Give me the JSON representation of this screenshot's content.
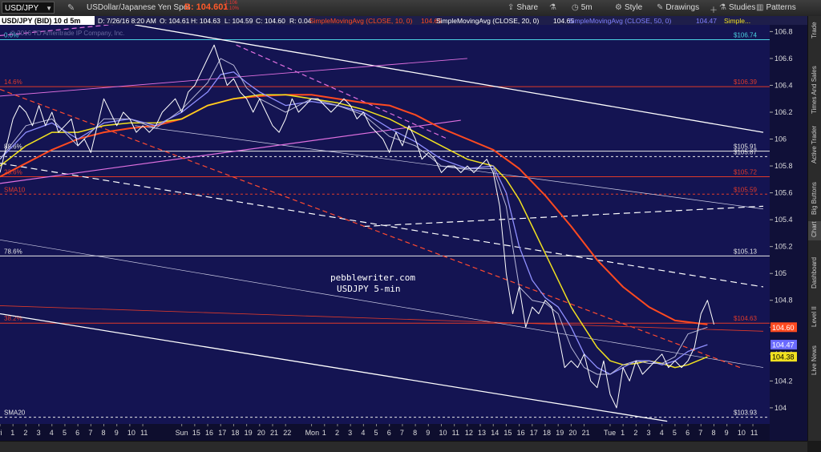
{
  "toolbar": {
    "symbol": "USD/JPY",
    "description": "USDollar/Japanese Yen Spot",
    "bid_label": "B: 104.601",
    "change_top": "-1.106",
    "change_bottom": "-1.10%",
    "tools": [
      {
        "name": "share",
        "label": "Share",
        "icon": "share-icon"
      },
      {
        "name": "studies-flask",
        "label": "",
        "icon": "flask-icon"
      },
      {
        "name": "timeframe",
        "label": "5m",
        "icon": "clock-icon"
      },
      {
        "name": "style",
        "label": "Style",
        "icon": "gear-icon"
      },
      {
        "name": "drawings",
        "label": "Drawings",
        "icon": "pencil-icon"
      },
      {
        "name": "add",
        "label": "",
        "icon": "plus-icon"
      },
      {
        "name": "studies",
        "label": "Studies",
        "icon": "flask-icon"
      },
      {
        "name": "patterns",
        "label": "Patterns",
        "icon": "bars-icon"
      }
    ]
  },
  "sidebar_tabs": [
    "Trade",
    "Times And Sales",
    "Active Trader",
    "Big Buttons",
    "Chart",
    "Dashboard",
    "Level II",
    "Live News"
  ],
  "sidebar_active": "Chart",
  "chart_data": {
    "type": "line",
    "header": {
      "title": "USD/JPY (BID) 10 d 5m",
      "date": "D: 7/26/16 8:20 AM",
      "open": "O: 104.61",
      "high": "H: 104.63",
      "low": "L: 104.59",
      "close": "C: 104.60",
      "range": "R: 0.04",
      "sma10_label": "SimpleMovingAvg (CLOSE, 10, 0)",
      "sma10_value": "104.65",
      "sma20_label": "SimpleMovingAvg (CLOSE, 20, 0)",
      "sma20_value": "104.65",
      "sma50_label": "SimpleMovingAvg (CLOSE, 50, 0)",
      "sma50_value": "104.47",
      "simple_label": "Simple...",
      "copyright": "© 2016 TD Ameritrade IP Company, Inc."
    },
    "annotation": [
      "pebblewriter.com",
      "USDJPY 5-min"
    ],
    "ylim": [
      103.88,
      106.85
    ],
    "y_ticks": [
      104,
      104.2,
      104.4,
      104.6,
      104.8,
      105,
      105.2,
      105.4,
      105.6,
      105.8,
      106,
      106.2,
      106.4,
      106.6,
      106.8
    ],
    "y_tick_labels": [
      "104",
      "104.2",
      "104.4",
      "104.6",
      "104.8",
      "105",
      "105.2",
      "105.4",
      "105.6",
      "105.8",
      "106",
      "106.2",
      "106.4",
      "106.6",
      "106.8"
    ],
    "x_ticks": [
      {
        "label": "Fri",
        "x": 0
      },
      {
        "label": "1",
        "x": 1
      },
      {
        "label": "2",
        "x": 2
      },
      {
        "label": "3",
        "x": 3
      },
      {
        "label": "4",
        "x": 4
      },
      {
        "label": "5",
        "x": 5
      },
      {
        "label": "6",
        "x": 6
      },
      {
        "label": "7",
        "x": 7
      },
      {
        "label": "8",
        "x": 8
      },
      {
        "label": "9",
        "x": 9
      },
      {
        "label": "10",
        "x": 10
      },
      {
        "label": "11",
        "x": 11
      },
      {
        "label": "Sun",
        "x": 14
      },
      {
        "label": "15",
        "x": 15
      },
      {
        "label": "16",
        "x": 16
      },
      {
        "label": "17",
        "x": 17
      },
      {
        "label": "18",
        "x": 18
      },
      {
        "label": "19",
        "x": 19
      },
      {
        "label": "20",
        "x": 20
      },
      {
        "label": "21",
        "x": 21
      },
      {
        "label": "22",
        "x": 22
      },
      {
        "label": "Mon",
        "x": 24
      },
      {
        "label": "1",
        "x": 25
      },
      {
        "label": "2",
        "x": 26
      },
      {
        "label": "3",
        "x": 27
      },
      {
        "label": "4",
        "x": 28
      },
      {
        "label": "5",
        "x": 29
      },
      {
        "label": "6",
        "x": 30
      },
      {
        "label": "7",
        "x": 31
      },
      {
        "label": "8",
        "x": 32
      },
      {
        "label": "9",
        "x": 33
      },
      {
        "label": "10",
        "x": 34
      },
      {
        "label": "11",
        "x": 35
      },
      {
        "label": "12",
        "x": 36
      },
      {
        "label": "13",
        "x": 37
      },
      {
        "label": "14",
        "x": 38
      },
      {
        "label": "15",
        "x": 39
      },
      {
        "label": "16",
        "x": 40
      },
      {
        "label": "17",
        "x": 41
      },
      {
        "label": "18",
        "x": 42
      },
      {
        "label": "19",
        "x": 43
      },
      {
        "label": "20",
        "x": 44
      },
      {
        "label": "21",
        "x": 45
      },
      {
        "label": "Tue",
        "x": 47
      },
      {
        "label": "1",
        "x": 48
      },
      {
        "label": "2",
        "x": 49
      },
      {
        "label": "3",
        "x": 50
      },
      {
        "label": "4",
        "x": 51
      },
      {
        "label": "5",
        "x": 52
      },
      {
        "label": "6",
        "x": 53
      },
      {
        "label": "7",
        "x": 54
      },
      {
        "label": "8",
        "x": 55
      },
      {
        "label": "9",
        "x": 56
      },
      {
        "label": "10",
        "x": 57
      },
      {
        "label": "11",
        "x": 58
      }
    ],
    "xlim": [
      0,
      58.8
    ],
    "levels": [
      {
        "name": "top-pct",
        "label": "100.0%",
        "value": 106.86,
        "right_label": "106.86",
        "color": "#dcdcdc",
        "dash": ""
      },
      {
        "name": "level-0",
        "label": "0.0%",
        "value": 106.74,
        "right_label": "$106.74",
        "color": "#4ad0e0",
        "dash": ""
      },
      {
        "name": "level-14",
        "label": "14.6%",
        "value": 106.39,
        "right_label": "$106.39",
        "color": "#e03a2a",
        "dash": ""
      },
      {
        "name": "level-88",
        "label": "88.6%",
        "value": 105.91,
        "right_label": "$105.91",
        "color": "#e8e8e8",
        "dash": ""
      },
      {
        "name": "level-sub",
        "label": "",
        "value": 105.87,
        "right_label": "$105.87",
        "color": "#e8e8e8",
        "dash": "3,3"
      },
      {
        "name": "level-23",
        "label": "23.6%",
        "value": 105.72,
        "right_label": "$105.72",
        "color": "#e03a2a",
        "dash": ""
      },
      {
        "name": "level-sma10",
        "label": "SMA10",
        "value": 105.59,
        "right_label": "$105.59",
        "color": "#e03a2a",
        "dash": "3,3"
      },
      {
        "name": "level-78",
        "label": "78.6%",
        "value": 105.13,
        "right_label": "$105.13",
        "color": "#e8e8e8",
        "dash": ""
      },
      {
        "name": "level-38",
        "label": "38.2%",
        "value": 104.63,
        "right_label": "$104.63",
        "color": "#e03a2a",
        "dash": ""
      },
      {
        "name": "level-sma20",
        "label": "SMA20",
        "value": 103.93,
        "right_label": "$103.93",
        "color": "#e8e8e8",
        "dash": "3,3"
      }
    ],
    "trendlines": [
      {
        "name": "white-channel-top",
        "points": [
          [
            10.4,
            106.85
          ],
          [
            58.8,
            106.05
          ]
        ],
        "color": "#ffffff",
        "width": 1.3,
        "dash": ""
      },
      {
        "name": "white-channel-bottom",
        "points": [
          [
            0,
            104.7
          ],
          [
            51.4,
            103.9
          ]
        ],
        "color": "#ffffff",
        "width": 1.3,
        "dash": ""
      },
      {
        "name": "white-thin-1",
        "points": [
          [
            0,
            105.25
          ],
          [
            58.8,
            104.3
          ]
        ],
        "color": "#cfcfe8",
        "width": 0.7,
        "dash": ""
      },
      {
        "name": "white-thin-2",
        "points": [
          [
            10.4,
            106.1
          ],
          [
            58.8,
            105.48
          ]
        ],
        "color": "#cfcfe8",
        "width": 0.7,
        "dash": ""
      },
      {
        "name": "white-dash-rising",
        "points": [
          [
            28,
            105.35
          ],
          [
            58.8,
            105.5
          ]
        ],
        "color": "#ffffff",
        "width": 1.2,
        "dash": "8,5"
      },
      {
        "name": "white-dash-falling",
        "points": [
          [
            0,
            105.82
          ],
          [
            58.8,
            104.9
          ]
        ],
        "color": "#ffffff",
        "width": 1.2,
        "dash": "8,5"
      },
      {
        "name": "magenta-upper",
        "points": [
          [
            0,
            106.32
          ],
          [
            36,
            106.6
          ]
        ],
        "color": "#e070e0",
        "width": 0.9,
        "dash": ""
      },
      {
        "name": "magenta-lower",
        "points": [
          [
            0,
            105.67
          ],
          [
            35.5,
            106.14
          ]
        ],
        "color": "#e070e0",
        "width": 1.2,
        "dash": ""
      },
      {
        "name": "magenta-dash-top",
        "points": [
          [
            0,
            106.77
          ],
          [
            10.5,
            106.87
          ]
        ],
        "color": "#e070e0",
        "width": 1.2,
        "dash": "6,4"
      },
      {
        "name": "magenta-dash-desc",
        "points": [
          [
            18.2,
            106.7
          ],
          [
            34.5,
            106.0
          ]
        ],
        "color": "#e070e0",
        "width": 1.2,
        "dash": "6,4"
      },
      {
        "name": "red-dash-desc",
        "points": [
          [
            0,
            106.37
          ],
          [
            57,
            104.3
          ]
        ],
        "color": "#ff4a30",
        "width": 1.2,
        "dash": "6,4"
      },
      {
        "name": "red-thin-long",
        "points": [
          [
            0,
            104.76
          ],
          [
            58.8,
            104.57
          ]
        ],
        "color": "#e03a2a",
        "width": 0.8,
        "dash": ""
      }
    ],
    "series": [
      {
        "key": "price",
        "color": "#ffffff",
        "width": 1,
        "x": [
          0,
          0.5,
          1,
          1.5,
          2,
          2.5,
          3,
          3.5,
          4,
          4.5,
          5,
          5.5,
          6,
          6.5,
          7,
          7.5,
          8,
          8.5,
          9,
          9.5,
          10,
          10.5,
          11,
          11.5,
          12,
          12.5,
          13,
          13.5,
          14,
          14.5,
          15,
          15.5,
          16,
          16.5,
          17,
          17.5,
          18,
          18.5,
          19,
          19.5,
          20,
          20.5,
          21,
          21.5,
          22,
          22.5,
          23,
          23.5,
          24,
          24.5,
          25,
          25.5,
          26,
          26.5,
          27,
          27.5,
          28,
          28.5,
          29,
          29.5,
          30,
          30.5,
          31,
          31.5,
          32,
          32.5,
          33,
          33.5,
          34,
          34.5,
          35,
          35.5,
          36,
          36.5,
          37,
          37.5,
          38,
          38.5,
          39,
          39.5,
          40,
          40.5,
          41,
          41.5,
          42,
          42.5,
          43,
          43.5,
          44,
          44.5,
          45,
          45.5,
          46,
          46.5,
          47,
          47.5,
          48,
          48.5,
          49,
          49.5,
          50,
          50.5,
          51,
          51.5,
          52,
          52.5,
          53,
          53.5,
          54,
          54.5,
          55
        ],
        "values": [
          105.75,
          105.95,
          106.15,
          106.25,
          106.2,
          106.1,
          106.25,
          106.1,
          106.2,
          106.05,
          106.1,
          106.15,
          105.95,
          106.0,
          105.9,
          106.1,
          106.3,
          106.2,
          106.1,
          106.2,
          106.15,
          106.05,
          106.1,
          106.05,
          106.1,
          106.2,
          106.25,
          106.3,
          106.2,
          106.35,
          106.4,
          106.5,
          106.6,
          106.7,
          106.55,
          106.4,
          106.45,
          106.35,
          106.3,
          106.2,
          106.3,
          106.2,
          106.1,
          106.05,
          106.15,
          106.3,
          106.2,
          106.25,
          106.3,
          106.3,
          106.25,
          106.2,
          106.25,
          106.3,
          106.25,
          106.15,
          106.2,
          106.1,
          106.05,
          106.0,
          105.9,
          106.05,
          105.95,
          106.1,
          106.0,
          105.85,
          105.9,
          105.85,
          105.75,
          105.8,
          105.8,
          105.75,
          105.8,
          105.75,
          105.8,
          105.85,
          105.75,
          105.5,
          105.0,
          104.7,
          104.9,
          104.6,
          104.75,
          104.7,
          104.8,
          104.75,
          104.55,
          104.3,
          104.35,
          104.3,
          104.4,
          104.2,
          104.15,
          104.35,
          104.1,
          104.0,
          104.3,
          104.2,
          104.35,
          104.25,
          104.3,
          104.35,
          104.4,
          104.3,
          104.35,
          104.3,
          104.35,
          104.45,
          104.7,
          104.8,
          104.62
        ]
      },
      {
        "key": "sma-red",
        "color": "#ff4a20",
        "width": 2,
        "x": [
          0,
          2,
          4,
          6,
          8,
          10,
          12,
          14,
          16,
          18,
          20,
          22,
          24,
          26,
          28,
          30,
          32,
          34,
          36,
          38,
          40,
          42,
          44,
          46,
          48,
          50,
          52,
          54.5
        ],
        "values": [
          105.72,
          105.82,
          105.92,
          106.0,
          106.05,
          106.08,
          106.1,
          106.15,
          106.25,
          106.3,
          106.32,
          106.33,
          106.33,
          106.3,
          106.27,
          106.25,
          106.18,
          106.08,
          106.0,
          105.92,
          105.78,
          105.58,
          105.35,
          105.1,
          104.9,
          104.75,
          104.65,
          104.62
        ]
      },
      {
        "key": "sma-yellow",
        "color": "#f0e020",
        "width": 1.5,
        "x": [
          0,
          2,
          4,
          6,
          8,
          10,
          12,
          14,
          16,
          18,
          20,
          22,
          24,
          26,
          28,
          30,
          32,
          34,
          36,
          38,
          39,
          40,
          41,
          42,
          43,
          44,
          45,
          46,
          47,
          48,
          49,
          50,
          51,
          52,
          53,
          54.5
        ],
        "values": [
          105.8,
          105.95,
          106.05,
          106.05,
          106.1,
          106.12,
          106.12,
          106.15,
          106.25,
          106.3,
          106.33,
          106.33,
          106.3,
          106.27,
          106.22,
          106.15,
          106.05,
          105.95,
          105.85,
          105.8,
          105.7,
          105.55,
          105.35,
          105.15,
          104.95,
          104.75,
          104.6,
          104.45,
          104.35,
          104.32,
          104.33,
          104.35,
          104.33,
          104.3,
          104.32,
          104.38
        ]
      },
      {
        "key": "sma-blue",
        "color": "#9090ff",
        "width": 1.3,
        "x": [
          0,
          2,
          4,
          6,
          8,
          10,
          12,
          14,
          16,
          17,
          18,
          19,
          20,
          22,
          24,
          26,
          28,
          30,
          32,
          34,
          36,
          38,
          39,
          40,
          41,
          42,
          43,
          44,
          45,
          46,
          47,
          48,
          49,
          50,
          51,
          52,
          53,
          54.5
        ],
        "values": [
          105.85,
          106.05,
          106.12,
          106.0,
          106.12,
          106.15,
          106.1,
          106.2,
          106.35,
          106.48,
          106.5,
          106.42,
          106.35,
          106.25,
          106.28,
          106.25,
          106.2,
          106.08,
          105.98,
          105.85,
          105.78,
          105.8,
          105.6,
          105.2,
          104.95,
          104.82,
          104.75,
          104.6,
          104.4,
          104.3,
          104.25,
          104.3,
          104.35,
          104.35,
          104.32,
          104.35,
          104.42,
          104.47
        ]
      },
      {
        "key": "sma-gray",
        "color": "#b8b8d8",
        "width": 1,
        "x": [
          0,
          2,
          4,
          6,
          8,
          10,
          12,
          14,
          16,
          17,
          18,
          19,
          20,
          22,
          24,
          26,
          28,
          30,
          32,
          34,
          36,
          38,
          39,
          40,
          41,
          42,
          43,
          44,
          45,
          46,
          47,
          48,
          49,
          50,
          51,
          52,
          53,
          54.5
        ],
        "values": [
          105.85,
          106.1,
          106.15,
          105.95,
          106.15,
          106.15,
          106.08,
          106.22,
          106.42,
          106.6,
          106.55,
          106.38,
          106.3,
          106.2,
          106.3,
          106.25,
          106.18,
          106.02,
          105.95,
          105.8,
          105.78,
          105.78,
          105.5,
          104.9,
          104.8,
          104.78,
          104.7,
          104.45,
          104.3,
          104.25,
          104.25,
          104.32,
          104.35,
          104.33,
          104.33,
          104.38,
          104.55,
          104.6
        ]
      }
    ],
    "price_tags": [
      {
        "name": "tag-last",
        "value": 104.6,
        "text": "104.60",
        "bg": "#ff4a20",
        "fg": "#ffffff"
      },
      {
        "name": "tag-sma50",
        "value": 104.47,
        "text": "104.47",
        "bg": "#6a6aff",
        "fg": "#ffffff"
      },
      {
        "name": "tag-yellow",
        "value": 104.38,
        "text": "104.38",
        "bg": "#f0e020",
        "fg": "#000000"
      }
    ]
  }
}
